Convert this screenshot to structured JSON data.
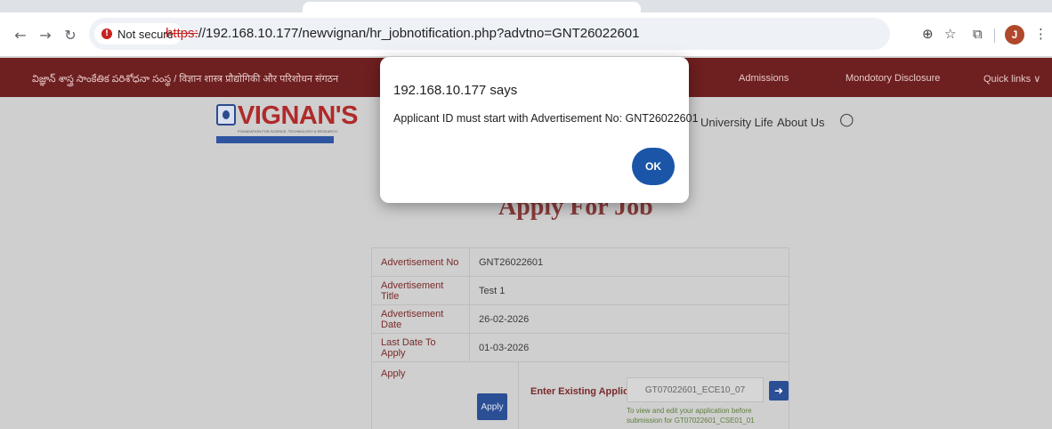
{
  "browser": {
    "security_label": "Not secure",
    "url_scheme": "https:",
    "url_rest": "//192.168.10.177/newvignan/hr_jobnotification.php?advtno=GNT26022601",
    "profile_initial": "J",
    "icons": [
      "back-arrow-icon",
      "forward-arrow-icon",
      "reload-icon",
      "zoom-icon",
      "bookmark-star-icon",
      "extensions-icon",
      "menu-icon"
    ]
  },
  "topbar": {
    "tagline": "విజ్ఞాన్ శాస్త్ర సాంకేతిక పరిశోధనా సంస్థ / विज्ञान शास्त्र प्रौद्योगिकी और परिशोधन संगठन",
    "links": [
      "Admissions",
      "Mondotory Disclosure",
      "Quick links ∨"
    ]
  },
  "logo": {
    "name": "VIGNAN'S",
    "sub": "FOUNDATION FOR SCIENCE, TECHNOLOGY & RESEARCH"
  },
  "nav": {
    "items": [
      "University Life",
      "About Us"
    ]
  },
  "content": {
    "title": "Apply For Job",
    "rows": [
      {
        "label": "Advertisement No",
        "value": "GNT26022601"
      },
      {
        "label": "Advertisement Title",
        "value": "Test 1"
      },
      {
        "label": "Advertisement Date",
        "value": "26-02-2026"
      },
      {
        "label": "Last Date To Apply",
        "value": "01-03-2026"
      }
    ],
    "apply_label": "Apply",
    "apply_button": "Apply",
    "existing_label": "Enter Existing Applicant ID",
    "existing_value": "GT07022601_ECE10_07",
    "hint": "To view and edit your application before submission for GT07022601_CSE01_01"
  },
  "dialog": {
    "origin": "192.168.10.177 says",
    "message": "Applicant ID must start with Advertisement No: GNT26022601",
    "ok_label": "OK"
  },
  "colors": {
    "topbar": "#6e1f1f",
    "page_bg": "#cfcfcf",
    "ok_button": "#1a55a8",
    "brand_red": "#b02a2a",
    "brand_blue": "#2f55a0"
  }
}
